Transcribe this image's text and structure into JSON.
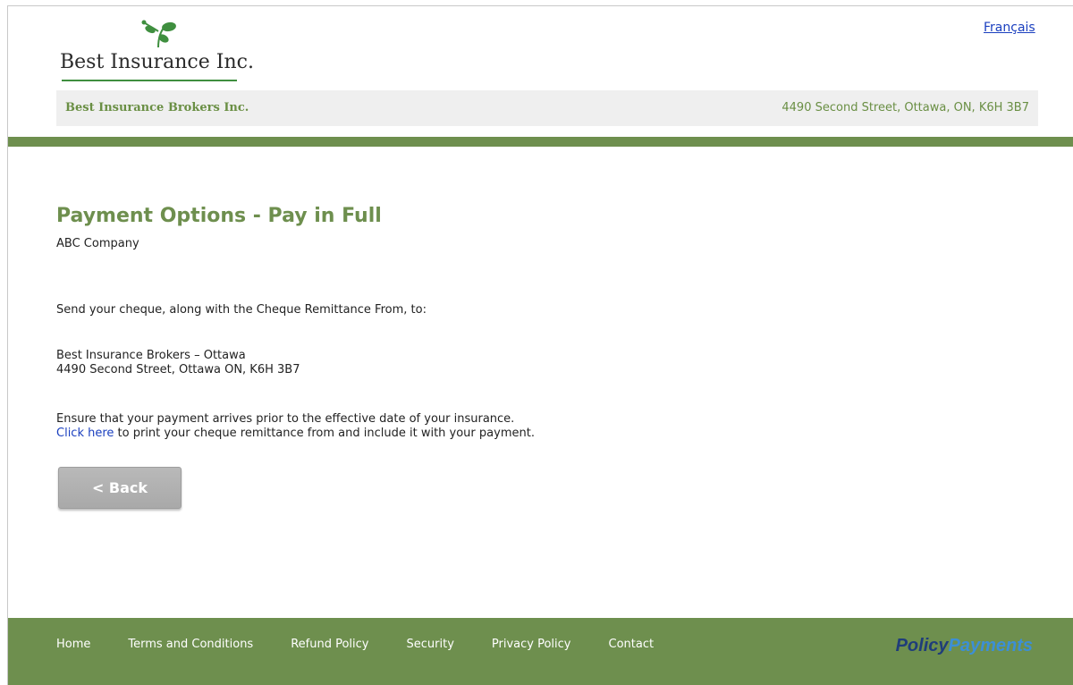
{
  "header": {
    "logo_text": "Best Insurance Inc.",
    "language_link": "Français"
  },
  "broker": {
    "name": "Best Insurance Brokers Inc.",
    "address": "4490 Second Street, Ottawa, ON, K6H 3B7"
  },
  "main": {
    "title": "Payment Options - Pay in Full",
    "company": "ABC Company",
    "send_instruction": "Send your cheque, along with the Cheque Remittance From, to:",
    "mail_name": "Best Insurance Brokers – Ottawa",
    "mail_address": "4490 Second Street, Ottawa ON, K6H 3B7",
    "ensure_text": "Ensure that your payment arrives prior to the effective date of your insurance.",
    "click_link": "Click here",
    "click_rest": " to print your cheque remittance from and include it with your payment.",
    "back_button": "< Back"
  },
  "footer": {
    "links": [
      "Home",
      "Terms and Conditions",
      "Refund Policy",
      "Security",
      "Privacy Policy",
      "Contact"
    ],
    "brand_part1": "Policy",
    "brand_part2": "Payments"
  },
  "colors": {
    "accent_green": "#6e8f4e",
    "link_blue": "#1a3fbf",
    "button_gray": "#b1b1b1"
  }
}
